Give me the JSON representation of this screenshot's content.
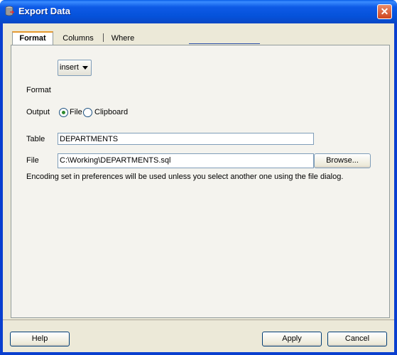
{
  "window": {
    "title": "Export Data",
    "close_glyph": "✕"
  },
  "tabs": [
    {
      "label": "Format",
      "active": true
    },
    {
      "label": "Columns",
      "active": false
    },
    {
      "label": "Where",
      "active": false
    }
  ],
  "form": {
    "format_label": "Format",
    "format_value": "insert",
    "output_label": "Output",
    "output_options": [
      {
        "label": "File",
        "selected": true
      },
      {
        "label": "Clipboard",
        "selected": false
      }
    ],
    "table_label": "Table",
    "table_value": "DEPARTMENTS",
    "file_label": "File",
    "file_value": "C:\\Working\\DEPARTMENTS.sql",
    "browse_label": "Browse...",
    "encoding_note": "Encoding set in preferences will be used unless you select another one using the file dialog."
  },
  "buttons": {
    "help": "Help",
    "apply": "Apply",
    "cancel": "Cancel"
  },
  "icons": {
    "title_icon": "database-export-icon",
    "close_icon": "close-icon"
  }
}
